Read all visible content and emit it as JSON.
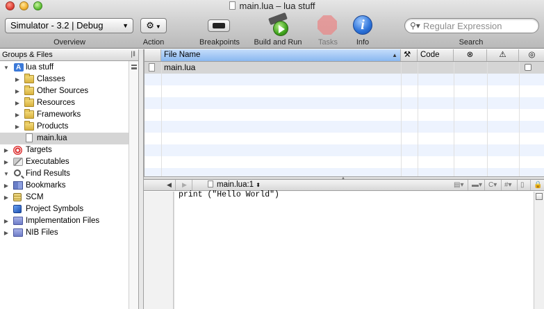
{
  "window": {
    "title": "main.lua – lua stuff"
  },
  "toolbar": {
    "scheme": {
      "value": "Simulator - 3.2 | Debug",
      "label": "Overview"
    },
    "action": {
      "label": "Action",
      "icon": "gear-icon"
    },
    "breakpoints": {
      "label": "Breakpoints"
    },
    "build_and_run": {
      "label": "Build and Run"
    },
    "tasks": {
      "label": "Tasks"
    },
    "info": {
      "label": "Info",
      "glyph": "i"
    },
    "search": {
      "placeholder": "Regular Expression",
      "label": "Search"
    }
  },
  "sidebar": {
    "header": "Groups & Files",
    "items": [
      {
        "label": "lua stuff",
        "icon": "project-icon",
        "expanded": true
      },
      {
        "label": "Classes",
        "icon": "folder-icon"
      },
      {
        "label": "Other Sources",
        "icon": "folder-icon"
      },
      {
        "label": "Resources",
        "icon": "folder-icon"
      },
      {
        "label": "Frameworks",
        "icon": "folder-icon"
      },
      {
        "label": "Products",
        "icon": "folder-icon"
      },
      {
        "label": "main.lua",
        "icon": "file-icon",
        "selected": true
      },
      {
        "label": "Targets",
        "icon": "target-icon"
      },
      {
        "label": "Executables",
        "icon": "executable-icon"
      },
      {
        "label": "Find Results",
        "icon": "magnifier-icon",
        "expanded": true
      },
      {
        "label": "Bookmarks",
        "icon": "bookmark-icon"
      },
      {
        "label": "SCM",
        "icon": "scm-icon"
      },
      {
        "label": "Project Symbols",
        "icon": "symbols-icon"
      },
      {
        "label": "Implementation Files",
        "icon": "smart-group-icon"
      },
      {
        "label": "NIB Files",
        "icon": "smart-group-icon"
      }
    ]
  },
  "file_list": {
    "columns": {
      "file_name": "File Name",
      "code": "Code"
    },
    "rows": [
      {
        "name": "main.lua"
      }
    ]
  },
  "editor": {
    "breadcrumb": "main.lua:1",
    "code": "print (\"Hello World\")"
  },
  "colors": {
    "selection": "#d5d5d5",
    "alt_row": "#edf3fe",
    "sorted_header": "#8ab8f0"
  }
}
